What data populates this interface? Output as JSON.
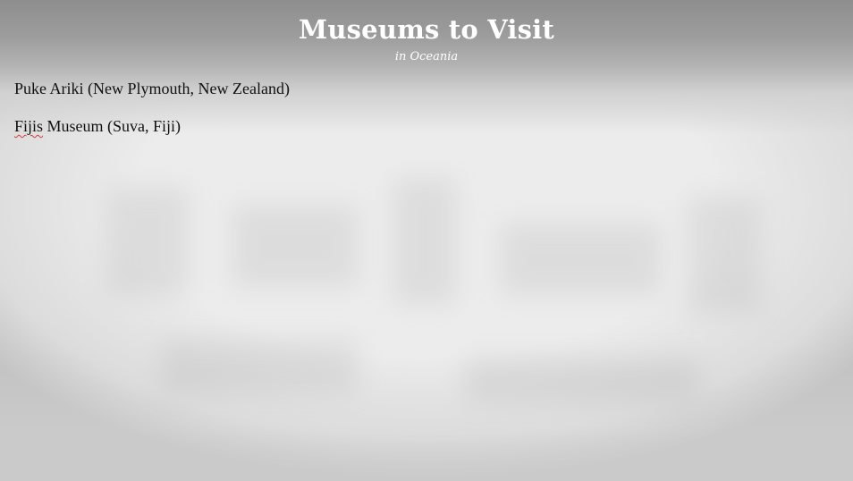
{
  "slide": {
    "title": "Museums to Visit",
    "subtitle": "in Oceania",
    "items": [
      {
        "text": "Puke Ariki (New Plymouth, New Zealand)"
      },
      {
        "text_misspelled": "Fijis",
        "text_rest": " Museum (Suva, Fiji)"
      }
    ]
  },
  "colors": {
    "title": "#ffffff",
    "body_text": "#111111",
    "spellcheck_underline": "#d23b3b",
    "background_top": "#8e8e8e",
    "background_center": "#ececec"
  }
}
